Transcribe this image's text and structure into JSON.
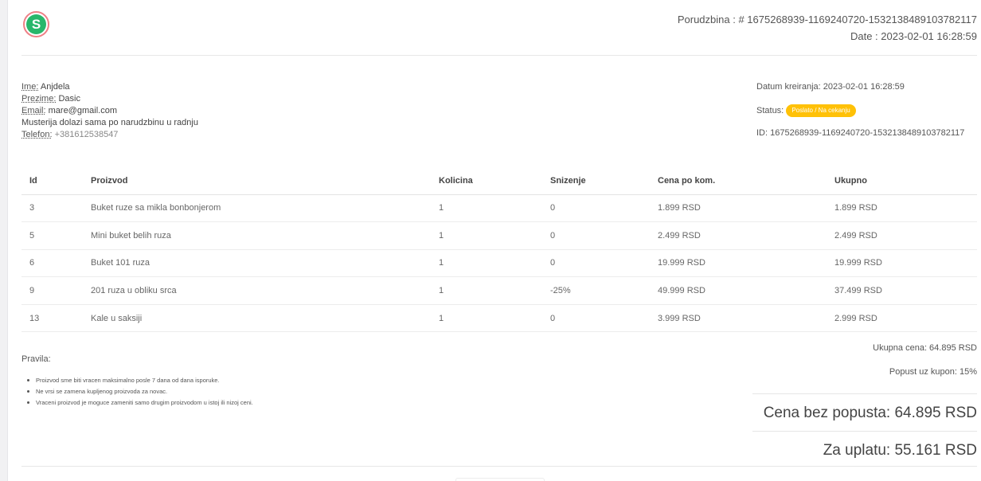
{
  "brand": {
    "logo_letter": "S"
  },
  "header": {
    "order_label": "Porudzbina : # 1675268939-1169240720-1532138489103782117",
    "date_label": "Date : 2023-02-01 16:28:59"
  },
  "customer": {
    "name_label": "Ime:",
    "name": "Anjdela",
    "surname_label": "Prezime:",
    "surname": "Dasic",
    "email_label": "Email:",
    "email": "mare@gmail.com",
    "note": "Musterija dolazi sama po narudzbinu u radnju",
    "phone_label": "Telefon:",
    "phone": "+381612538547"
  },
  "order_meta": {
    "created": "Datum kreiranja: 2023-02-01 16:28:59",
    "status_label": "Status:",
    "status": "Poslato / Na cekanju",
    "id": "ID: 1675268939-1169240720-1532138489103782117"
  },
  "table": {
    "headers": [
      "Id",
      "Proizvod",
      "Kolicina",
      "Snizenje",
      "Cena po kom.",
      "Ukupno"
    ],
    "rows": [
      [
        "3",
        "Buket ruze sa mikla bonbonjerom",
        "1",
        "0",
        "1.899 RSD",
        "1.899 RSD"
      ],
      [
        "5",
        "Mini buket belih ruza",
        "1",
        "0",
        "2.499 RSD",
        "2.499 RSD"
      ],
      [
        "6",
        "Buket 101 ruza",
        "1",
        "0",
        "19.999 RSD",
        "19.999 RSD"
      ],
      [
        "9",
        "201 ruza u obliku srca",
        "1",
        "-25%",
        "49.999 RSD",
        "37.499 RSD"
      ],
      [
        "13",
        "Kale u saksiji",
        "1",
        "0",
        "3.999 RSD",
        "2.999 RSD"
      ]
    ]
  },
  "rules": {
    "title": "Pravila:",
    "items": [
      "Proizvod sme biti vracen maksimalno posle 7 dana od dana isporuke.",
      "Ne vrsi se zamena kupljenog proizvoda za novac.",
      "Vraceni proizvod je moguce zameniti samo drugim proizvodom u istoj ili nizoj ceni."
    ]
  },
  "totals": {
    "total_price": "Ukupna cena: 64.895 RSD",
    "coupon": "Popust uz kupon: 15%",
    "without_discount": "Cena bez popusta: 64.895 RSD",
    "to_pay": "Za uplatu: 55.161 RSD"
  },
  "colors": {
    "status_badge": "#ffc107",
    "logo_fill": "#28b76b",
    "logo_ring": "#ee7f86"
  }
}
